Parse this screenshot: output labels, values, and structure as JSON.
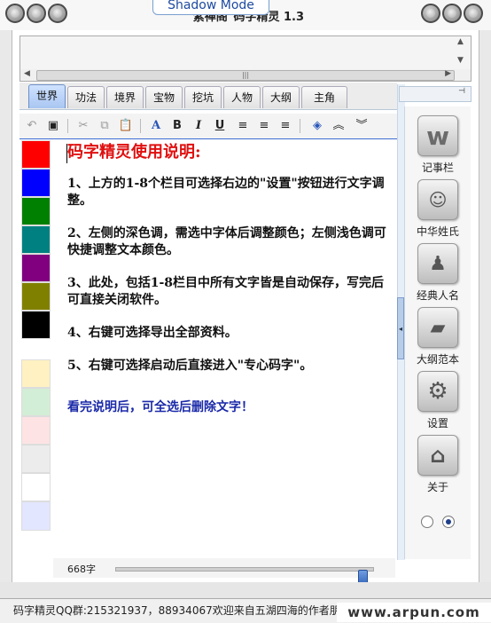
{
  "window": {
    "title": "\"紫禅阁\"码字精灵 1.3",
    "mode_tab": "Shadow Mode"
  },
  "tabs": [
    "世界",
    "功法",
    "境界",
    "宝物",
    "挖坑",
    "人物",
    "大纲",
    "主角"
  ],
  "active_tab": "世界",
  "toolbar": {
    "bold": "B",
    "italic": "I",
    "underline": "U",
    "font": "A"
  },
  "colors": {
    "dark": [
      "#ff0000",
      "#0000ff",
      "#008000",
      "#008080",
      "#800080",
      "#808000",
      "#000000"
    ],
    "light": [
      "#fff1c2",
      "#d3eed6",
      "#fde3e3",
      "#ececec",
      "#ffffff",
      "#e3e6ff"
    ]
  },
  "document": {
    "title": "码字精灵使用说明:",
    "items": [
      "1、上方的1-8个栏目可选择右边的\"设置\"按钮进行文字调整。",
      "2、左侧的深色调，需选中字体后调整颜色；左侧浅色调可快捷调整文本颜色。",
      "3、此处，包括1-8栏目中所有文字皆是自动保存，写完后可直接关闭软件。",
      "4、右键可选择导出全部资料。",
      "5、右键可选择启动后直接进入\"专心码字\"。"
    ],
    "note": "看完说明后，可全选后删除文字！"
  },
  "word_count": "668字",
  "word_slider_value": 0.97,
  "right_panel": [
    {
      "label": "记事栏",
      "icon": "notebook-w-icon"
    },
    {
      "label": "中华姓氏",
      "icon": "finder-face-icon"
    },
    {
      "label": "经典人名",
      "icon": "penguin-icon"
    },
    {
      "label": "大纲范本",
      "icon": "folder-icon"
    },
    {
      "label": "设置",
      "icon": "gear-icon"
    },
    {
      "label": "关于",
      "icon": "home-icon"
    }
  ],
  "status": {
    "text": "码字精灵QQ群:215321937，88934067欢迎来自五湖四海的作者朋友"
  },
  "watermark": "www.arpun.com"
}
